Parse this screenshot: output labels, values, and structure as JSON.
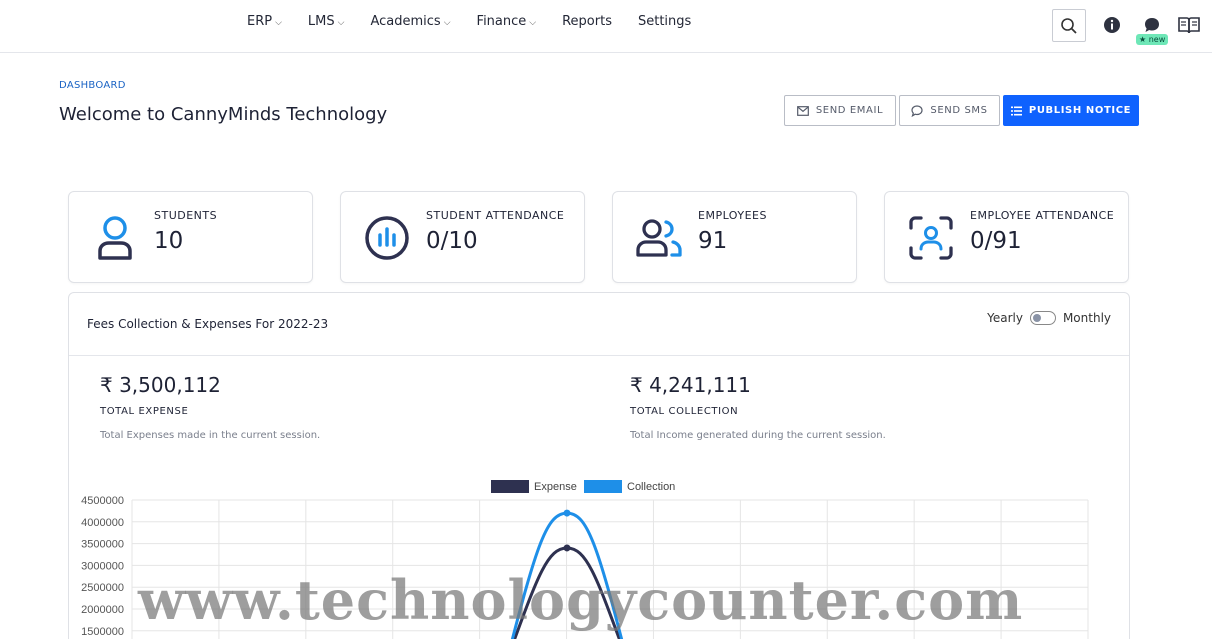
{
  "nav": {
    "items": [
      {
        "label": "ERP",
        "dropdown": true
      },
      {
        "label": "LMS",
        "dropdown": true
      },
      {
        "label": "Academics",
        "dropdown": true
      },
      {
        "label": "Finance",
        "dropdown": true
      },
      {
        "label": "Reports",
        "dropdown": false
      },
      {
        "label": "Settings",
        "dropdown": false
      }
    ],
    "badge_new": "★ new"
  },
  "header": {
    "breadcrumb": "DASHBOARD",
    "title": "Welcome to CannyMinds Technology",
    "send_email": "SEND EMAIL",
    "send_sms": "SEND SMS",
    "publish_notice": "PUBLISH NOTICE"
  },
  "cards": [
    {
      "label": "STUDENTS",
      "value": "10",
      "icon": "user-icon"
    },
    {
      "label": "STUDENT ATTENDANCE",
      "value": "0/10",
      "icon": "attendance-chart-icon"
    },
    {
      "label": "EMPLOYEES",
      "value": "91",
      "icon": "users-icon"
    },
    {
      "label": "EMPLOYEE ATTENDANCE",
      "value": "0/91",
      "icon": "face-scan-icon"
    }
  ],
  "fees": {
    "title": "Fees Collection & Expenses For 2022-23",
    "toggle_left": "Yearly",
    "toggle_right": "Monthly",
    "expense_value": "₹ 3,500,112",
    "expense_label": "TOTAL EXPENSE",
    "expense_desc": "Total Expenses made in the current session.",
    "collection_value": "₹ 4,241,111",
    "collection_label": "TOTAL COLLECTION",
    "collection_desc": "Total Income generated during the current session."
  },
  "colors": {
    "primary": "#0f62fe",
    "expense": "#2e3150",
    "collection": "#1e8fe8"
  },
  "chart_data": {
    "type": "line",
    "series": [
      {
        "name": "Expense",
        "peak": 3400000
      },
      {
        "name": "Collection",
        "peak": 4200000
      }
    ],
    "yticks": [
      "4500000",
      "4000000",
      "3500000",
      "3000000",
      "2500000",
      "2000000",
      "1500000"
    ],
    "ylim": [
      1500000,
      4500000
    ],
    "grid": true,
    "legend": "top"
  },
  "watermark": "www.technologycounter.com"
}
